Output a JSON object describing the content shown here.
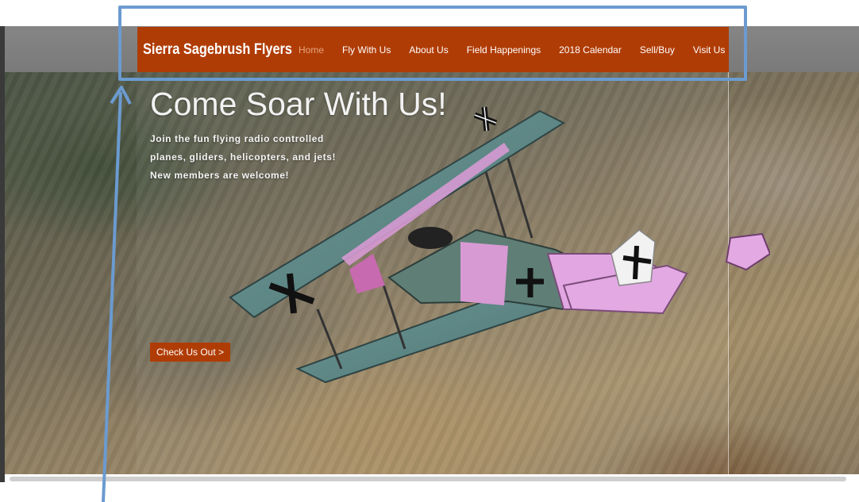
{
  "nav": {
    "brand": "Sierra Sagebrush Flyers",
    "items": [
      {
        "label": "Home"
      },
      {
        "label": "Fly With Us"
      },
      {
        "label": "About Us"
      },
      {
        "label": "Field Happenings"
      },
      {
        "label": "2018 Calendar"
      },
      {
        "label": "Sell/Buy"
      },
      {
        "label": "Visit Us"
      }
    ]
  },
  "hero": {
    "title": "Come Soar With Us!",
    "lines": [
      "Join the fun flying radio controlled",
      "planes, gliders, helicopters, and jets!",
      "New members are welcome!"
    ],
    "cta_label": "Check Us Out >"
  },
  "colors": {
    "brand": "#b03c05",
    "nav_active": "#e6a57f",
    "annotation": "#6b9bd0"
  },
  "icons": {
    "annotation_arrow": "arrow-up-icon",
    "hero_image": "biplane-icon"
  }
}
